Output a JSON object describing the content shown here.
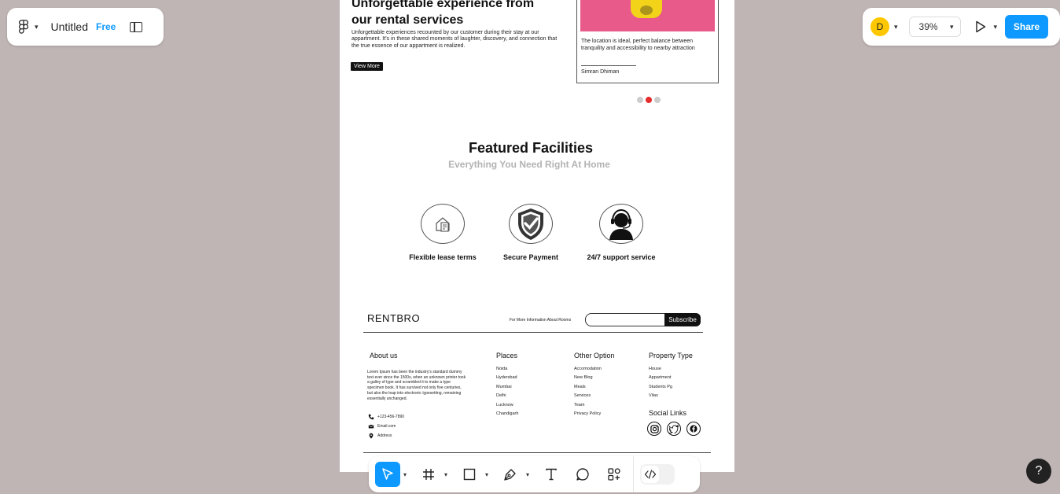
{
  "header": {
    "file_name": "Untitled",
    "plan_badge": "Free",
    "avatar_initial": "D",
    "zoom_level": "39%",
    "share_label": "Share"
  },
  "canvas": {
    "hero": {
      "title": "Unforgettable experience from our rental services",
      "text": "Unforgettable experiences recounted by our customer during their stay at our appartment. It's in these shared moments of laughter, discovery, and connection that the true essence of our appartment is realized.",
      "button": "View More"
    },
    "testimonial": {
      "quote": "The location is ideal, perfect balance between tranquility and accessibility  to nearby attraction",
      "author": "Simran Dhiman"
    },
    "facilities": {
      "title": "Featured Facilities",
      "subtitle": "Everything You Need Right At Home",
      "items": [
        {
          "label": "Flexible lease terms"
        },
        {
          "label": "Secure Payment"
        },
        {
          "label": "24/7 support service"
        }
      ]
    },
    "footer": {
      "brand": "RENTBRO",
      "info_text": "For More Information About Rooms",
      "subscribe_label": "Subscribe",
      "about": {
        "heading": "About us",
        "text": "Lorem Ipsum has been the industry's standard dummy text ever since the 1500s, when an unknown printer took a galley of type and scrambled it to make a type specimen book. It has survived not only five centuries, but also the leap into electronic typesetting, remaining essentially unchanged.",
        "phone": "+123-456-7890",
        "email": "Email.com",
        "address": "Address"
      },
      "places": {
        "heading": "Places",
        "items": [
          "Noida",
          "Hydersbad",
          "Mumbai",
          "Delhi",
          "Lucknow",
          "Chandigarh"
        ]
      },
      "other": {
        "heading": "Other Option",
        "items": [
          "Accomodation",
          "New Blog",
          "Meals",
          "Services",
          "Team",
          "Privacy Policy"
        ]
      },
      "property": {
        "heading": "Property Type",
        "items": [
          "House",
          "Appartment",
          "Students Pg",
          "Vilas"
        ]
      },
      "social_heading": "Social Links"
    }
  },
  "help_label": "?",
  "colors": {
    "accent": "#0d99ff",
    "canvas_bg": "#c0b5b5",
    "avatar": "#ffc700",
    "carousel_active": "#e52b2b"
  }
}
